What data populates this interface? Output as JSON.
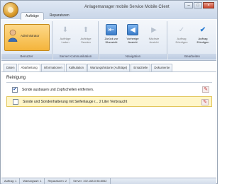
{
  "window": {
    "title": "Anlagemanager mobile Service Mobile Client"
  },
  "ribbon": {
    "tabs": [
      "Aufträge",
      "Reparaturen"
    ],
    "user": {
      "name": "Administrator",
      "group_label": "Benutzer"
    },
    "groups": [
      {
        "label": "Server Kommunikation",
        "buttons": [
          "Aufträge Laden",
          "Aufträge Senden"
        ]
      },
      {
        "label": "Navigation",
        "buttons": [
          "Zurück zur Übersicht",
          "Vorherige Ansicht",
          "Nächste Ansicht"
        ]
      },
      {
        "label": "Bearbeiten",
        "buttons": [
          "Auftrag Erledigen",
          "Auftrag Erledigen"
        ]
      }
    ]
  },
  "tabs": [
    "Daten",
    "Abarbeitung",
    "Informationen",
    "Kalkulation",
    "Wartungshistorie (Aufträge)",
    "Ersatzteile",
    "Dokumente"
  ],
  "content": {
    "section_title": "Reinigung",
    "tasks": [
      {
        "text": "Sonde ausbauen und Zopfschellen entfernen.",
        "checked": true
      },
      {
        "text": "Sonde und Sondenhalterung mit Seifenlauge r... 2 Liter Verbraucht",
        "checked": false
      }
    ]
  },
  "status": [
    "Auftrag: 1",
    "Wartungsart: 1",
    "Reparaturen: 2",
    "Server: 192.168.0.98:8052"
  ]
}
